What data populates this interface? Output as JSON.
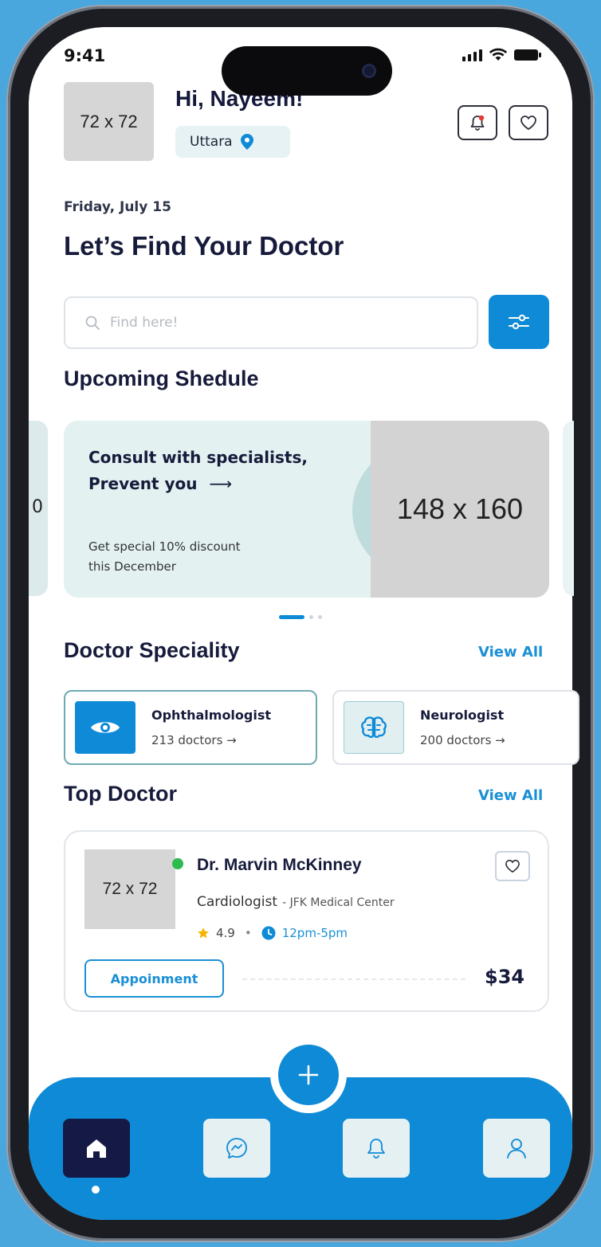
{
  "status_bar": {
    "time": "9:41"
  },
  "header": {
    "avatar_placeholder": "72 x 72",
    "greeting": "Hi, Nayeem!",
    "location": "Uttara"
  },
  "date": "Friday, July 15",
  "title": "Let’s Find Your Doctor",
  "search": {
    "placeholder": "Find here!"
  },
  "upcoming": {
    "section_title": "Upcoming Shedule",
    "banner": {
      "title_line1": "Consult with specialists,",
      "title_line2": "Prevent you",
      "arrow": "⟶",
      "subtitle_line1": "Get special 10% discount",
      "subtitle_line2": "this December",
      "image_placeholder": "148 x 160",
      "left_peek_text": "0"
    }
  },
  "speciality": {
    "section_title": "Doctor Speciality",
    "view_all": "View All",
    "items": [
      {
        "name": "Ophthalmologist",
        "count": "213 doctors →",
        "icon": "eye-icon"
      },
      {
        "name": "Neurologist",
        "count": "200 doctors →",
        "icon": "brain-icon"
      }
    ]
  },
  "top_doctor": {
    "section_title": "Top Doctor",
    "view_all": "View All",
    "doctor": {
      "photo_placeholder": "72 x 72",
      "name": "Dr. Marvin McKinney",
      "specialty": "Cardiologist",
      "hospital": "- JFK Medical Center",
      "rating": "4.9",
      "separator": "•",
      "hours": "12pm-5pm",
      "appointment_label": "Appoinment",
      "price": "$34"
    }
  },
  "bottom_nav": {
    "items": [
      {
        "name": "home",
        "icon": "home-icon",
        "active": true
      },
      {
        "name": "messages",
        "icon": "chat-icon",
        "active": false
      },
      {
        "name": "notifications",
        "icon": "bell-icon",
        "active": false
      },
      {
        "name": "profile",
        "icon": "user-icon",
        "active": false
      }
    ]
  },
  "colors": {
    "primary": "#0e8ad6",
    "dark": "#141a45",
    "banner_bg": "#e3f1f1",
    "online": "#2dbb4f",
    "star": "#f5b400",
    "background": "#4aa7de"
  }
}
